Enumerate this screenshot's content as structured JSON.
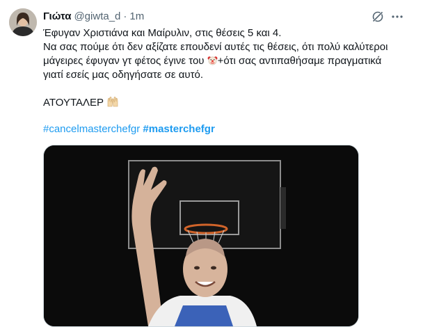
{
  "tweet": {
    "display_name": "Γιώτα",
    "handle": "@giwta_d",
    "separator": "·",
    "time": "1m",
    "line1": "Έφυγαν Χριστιάνα και Μαίρυλιν, στις θέσεις 5 και 4.",
    "line2": "Να σας πούμε ότι δεν αξίζατε επουδενί αυτές τις θέσεις, ότι πολύ καλύτεροι",
    "line3a": "μάγειρες έφυγαν γτ φέτος έγινε του ",
    "line3b": "+ότι σας αντιπαθήσαμε πραγματικά",
    "line4": "γιατί εσείς μας οδηγήσατε σε αυτό.",
    "line5": "ΑΤΟΥΤΑΛΕΡ",
    "hashtag1": "#cancelmasterchefgr",
    "hashtag2": "#masterchefgr"
  },
  "icons": {
    "grok": "grok-icon",
    "more": "more-icon",
    "clown": "clown-emoji",
    "hands": "raising-hands-emoji"
  },
  "colors": {
    "link": "#1d9bf0",
    "muted": "#536471",
    "text": "#0f1419"
  }
}
